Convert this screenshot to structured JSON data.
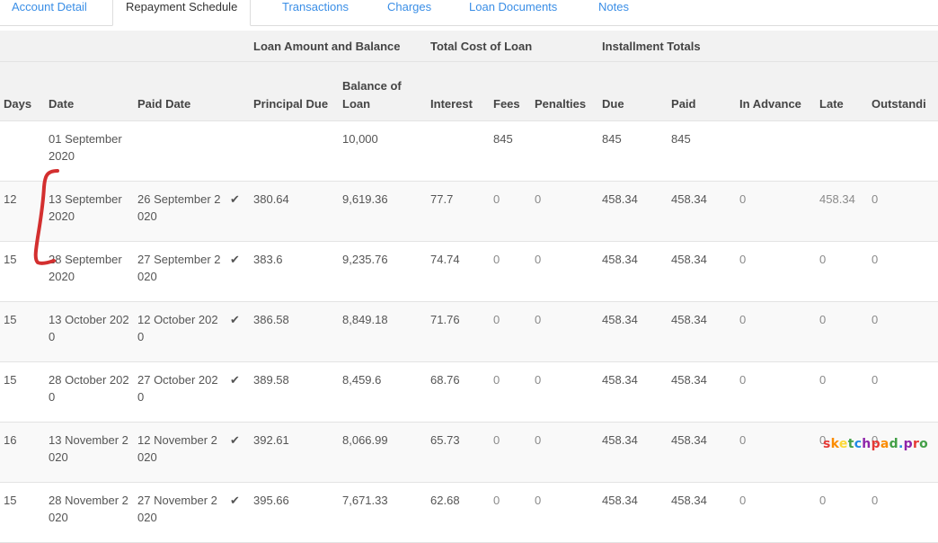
{
  "tabs": [
    {
      "label": "Account Detail"
    },
    {
      "label": "Repayment Schedule"
    },
    {
      "label": "Transactions"
    },
    {
      "label": "Charges"
    },
    {
      "label": "Loan Documents"
    },
    {
      "label": "Notes"
    }
  ],
  "groups": {
    "loan_amount": "Loan Amount and Balance",
    "total_cost": "Total Cost of Loan",
    "installment": "Installment Totals"
  },
  "columns": {
    "days": "Days",
    "date": "Date",
    "paid_date": "Paid Date",
    "principal_due": "Principal Due",
    "balance": "Balance of Loan",
    "interest": "Interest",
    "fees": "Fees",
    "penalties": "Penalties",
    "due": "Due",
    "paid": "Paid",
    "in_advance": "In Advance",
    "late": "Late",
    "outstanding": "Outstandi"
  },
  "rows": [
    {
      "days": "",
      "date": "01 September 2020",
      "paid_date": "",
      "check": "",
      "principal_due": "",
      "balance": "10,000",
      "interest": "",
      "fees": "845",
      "penalties": "",
      "due": "845",
      "paid": "845",
      "in_advance": "",
      "late": "",
      "outstanding": ""
    },
    {
      "days": "12",
      "date": "13 September 2020",
      "paid_date": "26 September 2020",
      "check": "✔",
      "principal_due": "380.64",
      "balance": "9,619.36",
      "interest": "77.7",
      "fees": "0",
      "penalties": "0",
      "due": "458.34",
      "paid": "458.34",
      "in_advance": "0",
      "late": "458.34",
      "outstanding": "0"
    },
    {
      "days": "15",
      "date": "28 September 2020",
      "paid_date": "27 September 2020",
      "check": "✔",
      "principal_due": "383.6",
      "balance": "9,235.76",
      "interest": "74.74",
      "fees": "0",
      "penalties": "0",
      "due": "458.34",
      "paid": "458.34",
      "in_advance": "0",
      "late": "0",
      "outstanding": "0"
    },
    {
      "days": "15",
      "date": "13 October 2020",
      "paid_date": "12 October 2020",
      "check": "✔",
      "principal_due": "386.58",
      "balance": "8,849.18",
      "interest": "71.76",
      "fees": "0",
      "penalties": "0",
      "due": "458.34",
      "paid": "458.34",
      "in_advance": "0",
      "late": "0",
      "outstanding": "0"
    },
    {
      "days": "15",
      "date": "28 October 2020",
      "paid_date": "27 October 2020",
      "check": "✔",
      "principal_due": "389.58",
      "balance": "8,459.6",
      "interest": "68.76",
      "fees": "0",
      "penalties": "0",
      "due": "458.34",
      "paid": "458.34",
      "in_advance": "0",
      "late": "0",
      "outstanding": "0"
    },
    {
      "days": "16",
      "date": "13 November 2020",
      "paid_date": "12 November 2020",
      "check": "✔",
      "principal_due": "392.61",
      "balance": "8,066.99",
      "interest": "65.73",
      "fees": "0",
      "penalties": "0",
      "due": "458.34",
      "paid": "458.34",
      "in_advance": "0",
      "late": "0",
      "outstanding": "0"
    },
    {
      "days": "15",
      "date": "28 November 2020",
      "paid_date": "27 November 2020",
      "check": "✔",
      "principal_due": "395.66",
      "balance": "7,671.33",
      "interest": "62.68",
      "fees": "0",
      "penalties": "0",
      "due": "458.34",
      "paid": "458.34",
      "in_advance": "0",
      "late": "0",
      "outstanding": "0"
    }
  ],
  "watermark": {
    "text": "sketchpad.pro",
    "colors": [
      "#e53935",
      "#fb8c00",
      "#fdd835",
      "#43a047",
      "#1e88e5",
      "#8e24aa",
      "#e53935",
      "#fb8c00",
      "#43a047",
      "#1e88e5",
      "#8e24aa",
      "#e53935",
      "#43a047"
    ]
  },
  "annotation": {
    "color": "#d32f2f"
  },
  "colors": {
    "link": "#3a8ee6",
    "header_bg": "#f2f2f2",
    "border": "#e3e3e3"
  }
}
